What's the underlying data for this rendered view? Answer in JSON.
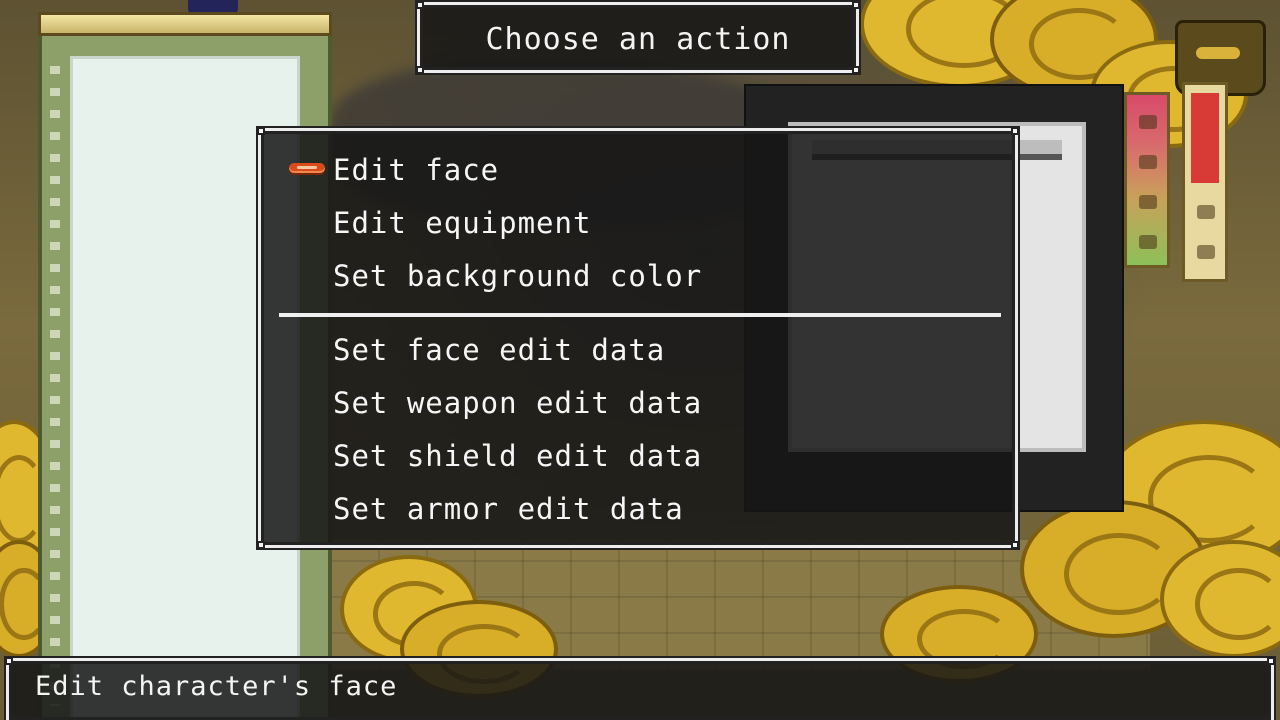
{
  "screen": {
    "title": "Choose an action"
  },
  "menu": {
    "selected_index": 0,
    "items": [
      {
        "label": "Edit face"
      },
      {
        "label": "Edit equipment"
      },
      {
        "label": "Set background color"
      },
      {
        "label": "Set face edit data"
      },
      {
        "label": "Set weapon edit data"
      },
      {
        "label": "Set shield edit data"
      },
      {
        "label": "Set armor edit data"
      }
    ]
  },
  "help": {
    "text": "Edit character's face"
  },
  "icons": {
    "cursor": "selection-cursor-icon"
  },
  "colors": {
    "panel_background": "#161616",
    "panel_border": "#ededed",
    "text": "#f6f6f6",
    "cursor": "#d94b1a",
    "cloud_gold": "#e0b830"
  }
}
